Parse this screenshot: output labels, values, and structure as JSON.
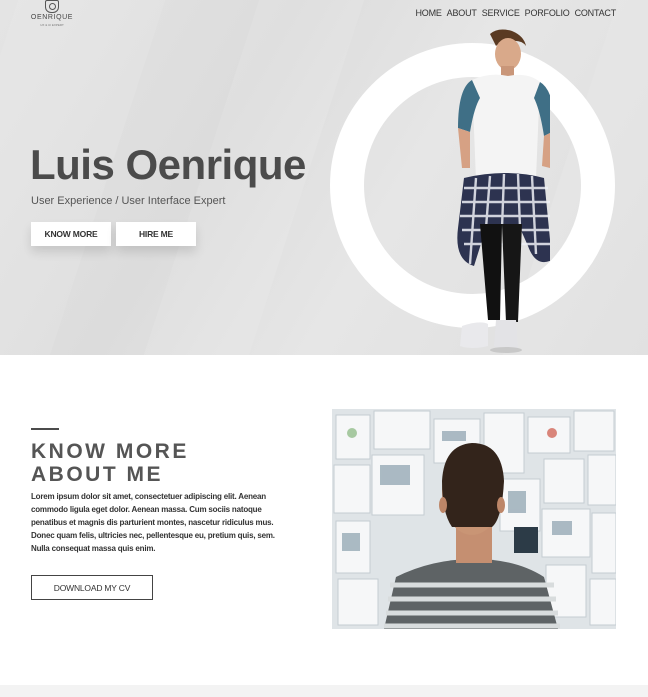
{
  "logo": {
    "text": "OENRIQUE",
    "sub": "UX & UI EXPERT"
  },
  "nav": {
    "items": [
      "HOME",
      "ABOUT",
      "SERVICE",
      "PORFOLIO",
      "CONTACT"
    ]
  },
  "hero": {
    "name": "Luis Oenrique",
    "subtitle": "User Experience / User Interface Expert",
    "know_more_label": "KNOW MORE",
    "hire_me_label": "HIRE ME"
  },
  "about": {
    "title_line1": "KNOW MORE",
    "title_line2": "ABOUT ME",
    "body": "Lorem ipsum dolor sit amet, consectetuer adipiscing elit. Aenean commodo ligula eget dolor. Aenean massa. Cum sociis natoque penatibus et magnis dis parturient montes, nascetur ridiculus mus. Donec quam felis, ultricies nec, pellentesque eu, pretium quis, sem. Nulla consequat massa quis enim.",
    "download_label": "DOWNLOAD MY CV"
  },
  "colors": {
    "hero_bg": "#dddddd",
    "text_dark": "#4b4b4b",
    "accent_blue": "#3f6f86"
  }
}
